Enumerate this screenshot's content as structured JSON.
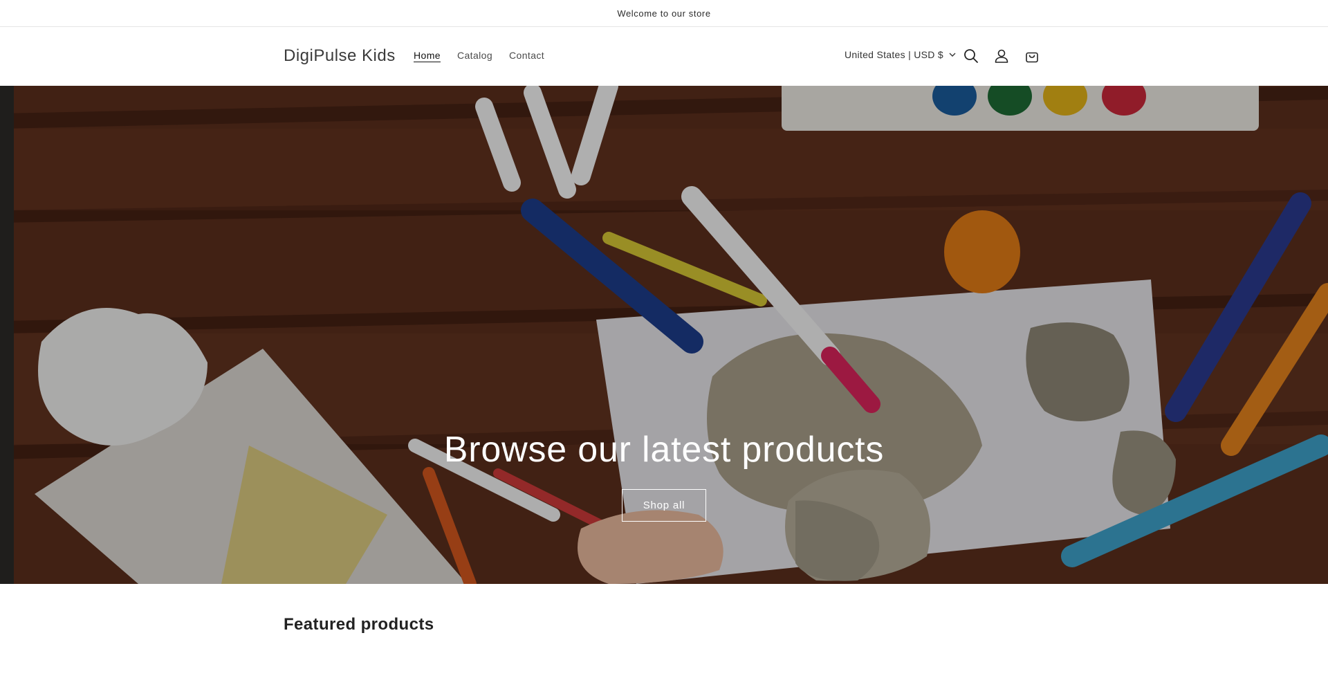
{
  "announcement": {
    "text": "Welcome to our store"
  },
  "header": {
    "logo": "DigiPulse Kids",
    "nav": [
      {
        "label": "Home",
        "active": true
      },
      {
        "label": "Catalog",
        "active": false
      },
      {
        "label": "Contact",
        "active": false
      }
    ],
    "localization": "United States | USD $",
    "icons": [
      "search-icon",
      "account-icon",
      "cart-icon"
    ]
  },
  "hero": {
    "heading": "Browse our latest products",
    "button_label": "Shop all"
  },
  "featured": {
    "title": "Featured products"
  },
  "colors": {
    "text": "#121212",
    "hero_wood": "#5a2e1c",
    "overlay": "rgba(0,0,0,0.28)"
  }
}
